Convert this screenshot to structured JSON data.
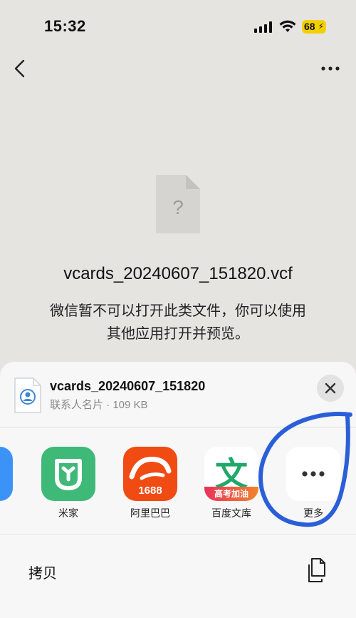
{
  "status": {
    "time": "15:32",
    "battery": "68"
  },
  "nav": {
    "back_icon": "chevron-left-icon",
    "more_icon": "more-horizontal-icon"
  },
  "file": {
    "name": "vcards_20240607_151820.vcf",
    "notice_line1": "微信暂不可以打开此类文件，你可以使用",
    "notice_line2": "其他应用打开并预览。",
    "placeholder_glyph": "?"
  },
  "sheet": {
    "title": "vcards_20240607_151820",
    "subtitle": "联系人名片 · 109 KB",
    "apps": [
      {
        "label": "米家"
      },
      {
        "label": "阿里巴巴",
        "icon_text": "1688"
      },
      {
        "label": "百度文库",
        "icon_text": "文",
        "badge": "高考加油"
      },
      {
        "label": "更多"
      }
    ],
    "copy_label": "拷贝"
  },
  "colors": {
    "mijia": "#3fb978",
    "alibaba": "#f04b12",
    "wenku_green": "#1fa86a",
    "accent_circle": "#2b5fd8"
  }
}
